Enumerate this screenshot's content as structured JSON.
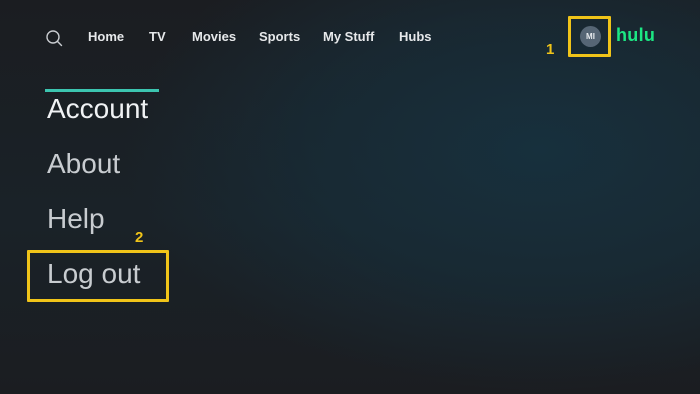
{
  "nav": {
    "items": [
      {
        "label": "Home"
      },
      {
        "label": "TV"
      },
      {
        "label": "Movies"
      },
      {
        "label": "Sports"
      },
      {
        "label": "My Stuff"
      },
      {
        "label": "Hubs"
      }
    ],
    "avatar_initials": "MI",
    "logo_text": "hulu"
  },
  "menu": {
    "items": [
      {
        "label": "Account",
        "active": true
      },
      {
        "label": "About"
      },
      {
        "label": "Help"
      },
      {
        "label": "Log out"
      }
    ]
  },
  "callouts": [
    "1",
    "2"
  ],
  "colors": {
    "highlight": "#f0c419",
    "brand": "#1ce783",
    "active_underline": "#3cc5b0"
  }
}
